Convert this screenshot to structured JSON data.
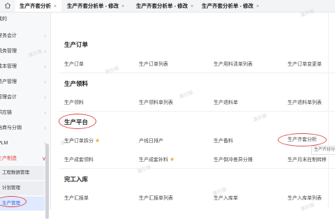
{
  "tabs": [
    {
      "label": "生产齐套分析",
      "active": true,
      "close": "×"
    },
    {
      "label": "生产齐套分析单 - 修改",
      "active": false,
      "close": "×"
    },
    {
      "label": "生产齐套分析单 - 修改",
      "active": false,
      "close": "×"
    },
    {
      "label": "生产齐套分析单 - 修改",
      "active": false,
      "close": "×"
    }
  ],
  "sidebar": {
    "items": [
      {
        "label": "我的",
        "chevron": ""
      },
      {
        "label": "财务会计",
        "chevron": "›"
      },
      {
        "label": "税务管理",
        "chevron": "›"
      },
      {
        "label": "成本管理",
        "chevron": "›"
      },
      {
        "label": "资产管理",
        "chevron": "›"
      },
      {
        "label": "管理会计",
        "chevron": "›"
      },
      {
        "label": "供应链",
        "chevron": "›"
      },
      {
        "label": "电商与分销",
        "chevron": "›"
      },
      {
        "label": "PLM",
        "chevron": "›"
      },
      {
        "label": "生产制造",
        "chevron": "∨"
      }
    ],
    "subitems": [
      {
        "label": "工程数据管理"
      },
      {
        "label": "计划管理"
      },
      {
        "label": "生产管理"
      }
    ]
  },
  "sections": [
    {
      "title": "生产订单",
      "links": [
        "生产订单",
        "生产订单列表",
        "生产用料清单列表",
        "生产订单变更单"
      ]
    },
    {
      "title": "生产领料",
      "links": [
        "生产领料",
        "生产领料单列表",
        "生产退料单",
        "生产退料单列表"
      ]
    },
    {
      "title": "生产平台",
      "links": [
        "生产订单拆分",
        "产线日排产",
        "生产备料",
        "生产齐套分析",
        "生产成套领料",
        "生产成套补料",
        "生产倒冲差异分摊",
        "生产月末在制转移"
      ]
    },
    {
      "title": "完工入库",
      "links": [
        "生产汇报单",
        "生产汇报单列表",
        "生产入库单",
        "生产入库单列表"
      ]
    }
  ],
  "tooltip": "生产齐套分",
  "watermark": "演示版",
  "colors": {
    "accent_red": "#e04848",
    "star": "#f5a623",
    "active_blue": "#3a66e0"
  }
}
